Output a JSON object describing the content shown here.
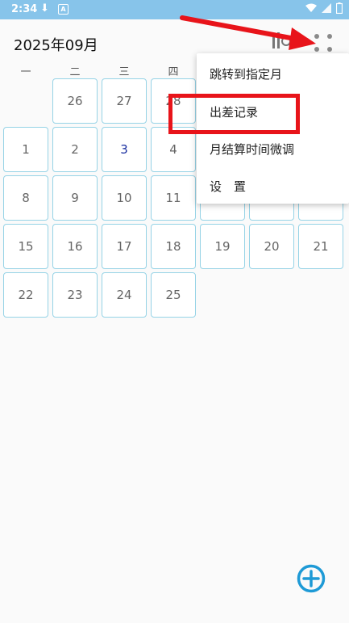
{
  "status_bar": {
    "time": "2:34"
  },
  "header": {
    "title": "2025年09月"
  },
  "weekdays": [
    "一",
    "二",
    "三",
    "四"
  ],
  "calendar": {
    "row0": [
      "26",
      "27",
      "28"
    ],
    "row1": [
      "1",
      "2",
      "3",
      "4"
    ],
    "row2": [
      "8",
      "9",
      "10",
      "11"
    ],
    "row3": [
      "15",
      "16",
      "17",
      "18",
      "19",
      "20",
      "21"
    ],
    "row4": [
      "22",
      "23",
      "24",
      "25"
    ]
  },
  "menu": {
    "items": [
      "跳转到指定月",
      "出差记录",
      "月结算时间微调",
      "设　置"
    ]
  },
  "colors": {
    "status_bar": "#87c4ea",
    "cell_border": "#96d3e6",
    "today_text": "#1a2fa0",
    "annotation_red": "#e8141a",
    "fab": "#1e9ad6"
  }
}
